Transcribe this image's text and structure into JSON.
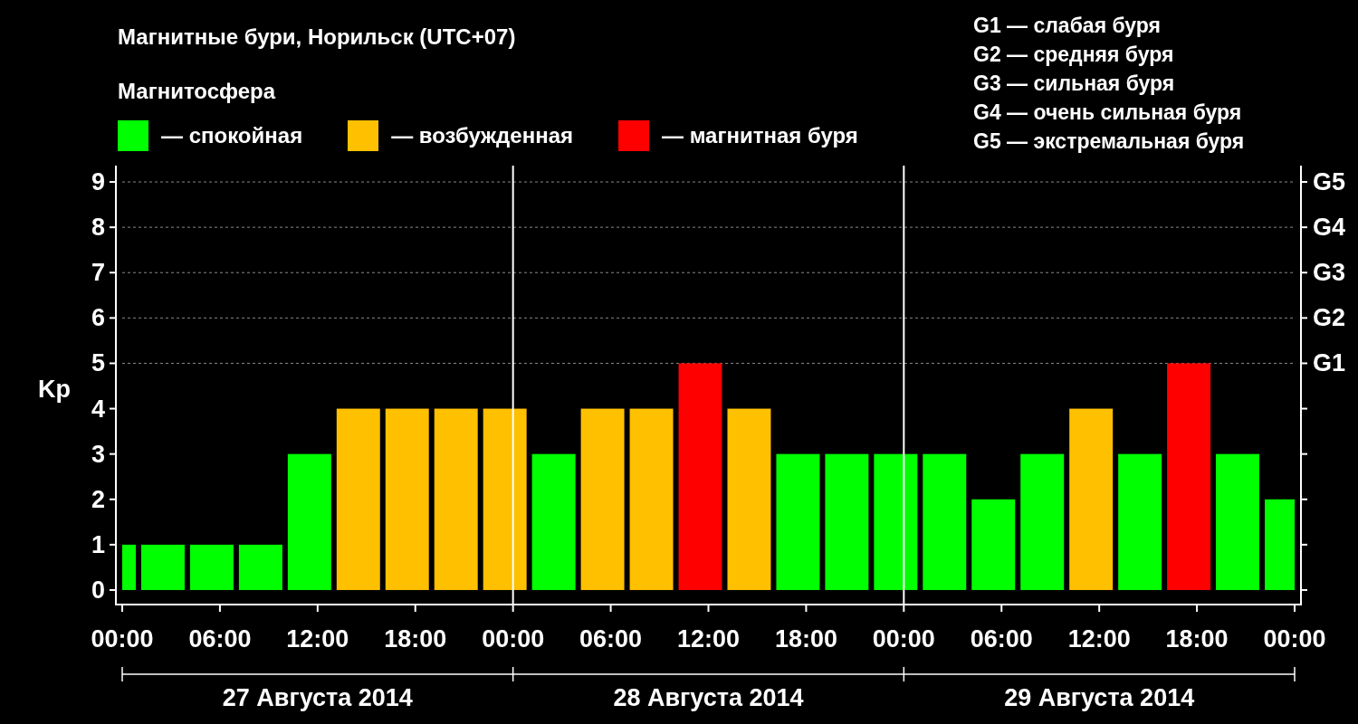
{
  "title": "Магнитные бури, Норильск (UTC+07)",
  "legend": {
    "title": "Магнитосфера",
    "items": [
      {
        "label": "— спокойная",
        "color": "#00ff00"
      },
      {
        "label": "— возбужденная",
        "color": "#ffc000"
      },
      {
        "label": "— магнитная буря",
        "color": "#ff0000"
      }
    ]
  },
  "storm_scale": [
    "G1 — слабая буря",
    "G2 — средняя буря",
    "G3 — сильная буря",
    "G4 — очень сильная буря",
    "G5 — экстремальная буря"
  ],
  "chart": {
    "right_axis_labels": [
      "G5",
      "G4",
      "G3",
      "G2",
      "G1"
    ],
    "days": [
      "27 Августа 2014",
      "28 Августа 2014",
      "29 Августа 2014"
    ],
    "chart_data": {
      "type": "bar",
      "ylabel": "Kp",
      "grid": true,
      "x": [
        "2014-08-27T00:30",
        "2014-08-27T02:30",
        "2014-08-27T05:30",
        "2014-08-27T08:30",
        "2014-08-27T11:30",
        "2014-08-27T14:30",
        "2014-08-27T17:30",
        "2014-08-27T20:30",
        "2014-08-27T23:30",
        "2014-08-28T02:30",
        "2014-08-28T05:30",
        "2014-08-28T08:30",
        "2014-08-28T11:30",
        "2014-08-28T14:30",
        "2014-08-28T17:30",
        "2014-08-28T20:30",
        "2014-08-28T23:30",
        "2014-08-29T02:30",
        "2014-08-29T05:30",
        "2014-08-29T08:30",
        "2014-08-29T11:30",
        "2014-08-29T14:30",
        "2014-08-29T17:30",
        "2014-08-29T20:30",
        "2014-08-29T23:00"
      ],
      "xlim": [
        "2014-08-27T00:00",
        "2014-08-30T00:00"
      ],
      "ylim": [
        -0.32,
        9.36
      ],
      "yticks": [
        0,
        1,
        2,
        3,
        4,
        5,
        6,
        7,
        8,
        9
      ],
      "xticks": [
        {
          "value": "2014-08-27T00:00",
          "label": "00:00"
        },
        {
          "value": "2014-08-27T06:00",
          "label": "06:00"
        },
        {
          "value": "2014-08-27T12:00",
          "label": "12:00"
        },
        {
          "value": "2014-08-27T18:00",
          "label": "18:00"
        },
        {
          "value": "2014-08-28T00:00",
          "label": "00:00"
        },
        {
          "value": "2014-08-28T06:00",
          "label": "06:00"
        },
        {
          "value": "2014-08-28T12:00",
          "label": "12:00"
        },
        {
          "value": "2014-08-28T18:00",
          "label": "18:00"
        },
        {
          "value": "2014-08-29T00:00",
          "label": "00:00"
        },
        {
          "value": "2014-08-29T06:00",
          "label": "06:00"
        },
        {
          "value": "2014-08-29T12:00",
          "label": "12:00"
        },
        {
          "value": "2014-08-29T18:00",
          "label": "18:00"
        },
        {
          "value": "2014-08-30T00:00",
          "label": "00:00"
        }
      ],
      "values": [
        1,
        1,
        1,
        1,
        3,
        4,
        4,
        4,
        4,
        3,
        4,
        4,
        5,
        4,
        3,
        3,
        3,
        3,
        2,
        3,
        4,
        3,
        5,
        3,
        2
      ]
    }
  }
}
